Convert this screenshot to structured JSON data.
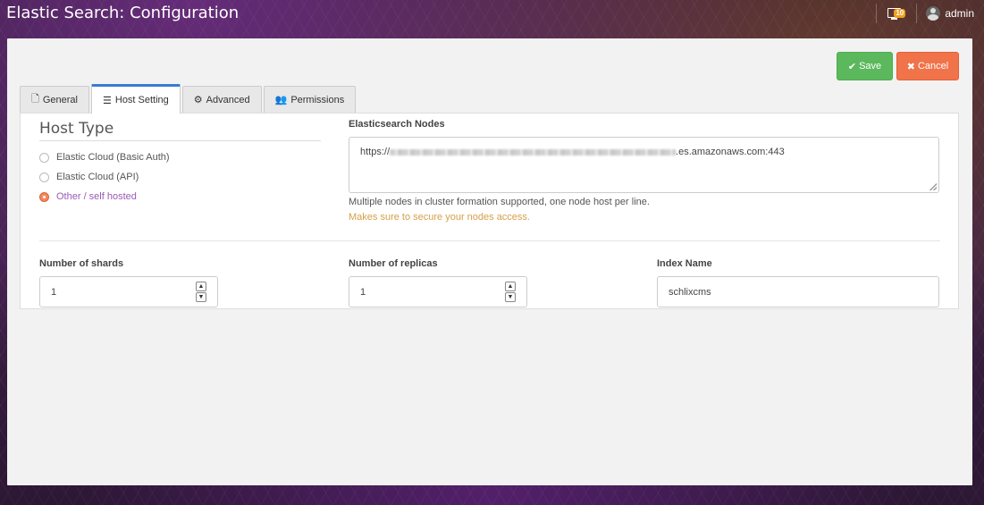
{
  "header": {
    "title": "Elastic Search: Configuration",
    "notification_count": "10",
    "username": "admin"
  },
  "actions": {
    "save_label": "Save",
    "cancel_label": "Cancel"
  },
  "tabs": [
    {
      "label": "General",
      "icon": "file-icon",
      "active": false
    },
    {
      "label": "Host Setting",
      "icon": "server-icon",
      "active": true
    },
    {
      "label": "Advanced",
      "icon": "gear-icon",
      "active": false
    },
    {
      "label": "Permissions",
      "icon": "users-icon",
      "active": false
    }
  ],
  "host_type": {
    "title": "Host Type",
    "options": [
      {
        "label": "Elastic Cloud (Basic Auth)",
        "checked": false
      },
      {
        "label": "Elastic Cloud (API)",
        "checked": false
      },
      {
        "label": "Other / self hosted",
        "checked": true
      }
    ]
  },
  "nodes": {
    "label": "Elasticsearch Nodes",
    "value_prefix": "https://",
    "value_suffix": ".es.amazonaws.com:443",
    "help": "Multiple nodes in cluster formation supported, one node host per line.",
    "warning": "Makes sure to secure your nodes access."
  },
  "shards": {
    "label": "Number of shards",
    "value": "1"
  },
  "replicas": {
    "label": "Number of replicas",
    "value": "1"
  },
  "index_name": {
    "label": "Index Name",
    "value": "schlixcms"
  },
  "colors": {
    "save": "#5cb85c",
    "cancel": "#f0734a",
    "active_tab": "#3a7bd5",
    "warning_text": "#d4a04a",
    "checked_radio": "#f08a5d"
  }
}
